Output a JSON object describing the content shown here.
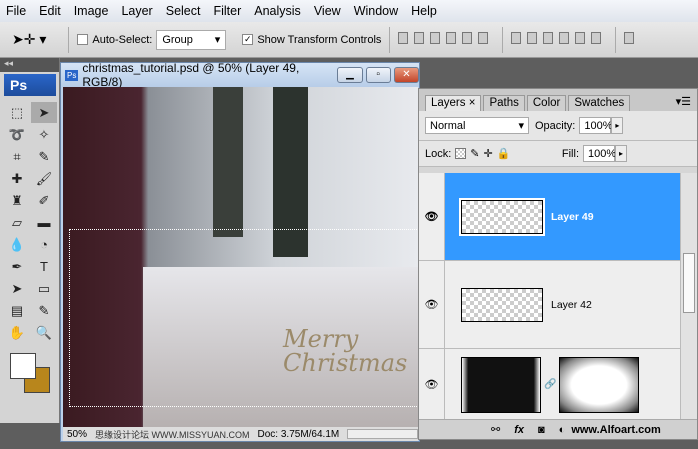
{
  "menu": [
    "File",
    "Edit",
    "Image",
    "Layer",
    "Select",
    "Filter",
    "Analysis",
    "View",
    "Window",
    "Help"
  ],
  "options": {
    "auto_select_label": "Auto-Select:",
    "auto_select_value": "Group",
    "show_transform_label": "Show Transform Controls",
    "show_transform_checked": true,
    "auto_select_checked": false
  },
  "toolbox": {
    "logo": "Ps",
    "collapse": "◂◂"
  },
  "document": {
    "title": "christmas_tutorial.psd @ 50% (Layer 49, RGB/8)",
    "zoom": "50%",
    "doc_info": "Doc: 3.75M/64.1M",
    "canvas_text": "Merry Christmas"
  },
  "panel": {
    "tabs": [
      "Layers",
      "Paths",
      "Color",
      "Swatches"
    ],
    "blend_mode": "Normal",
    "opacity_label": "Opacity:",
    "opacity": "100%",
    "lock_label": "Lock:",
    "fill_label": "Fill:",
    "fill": "100%",
    "layers": [
      {
        "name": "Layer 49",
        "selected": true
      },
      {
        "name": "Layer 42",
        "selected": false
      },
      {
        "name": "",
        "selected": false
      }
    ]
  },
  "watermarks": {
    "left": "思缘设计论坛 WWW.MISSYUAN.COM",
    "right": "www.Alfoart.com"
  },
  "colors": {
    "selection": "#3399ff",
    "background_swatch": "#b8861c"
  }
}
